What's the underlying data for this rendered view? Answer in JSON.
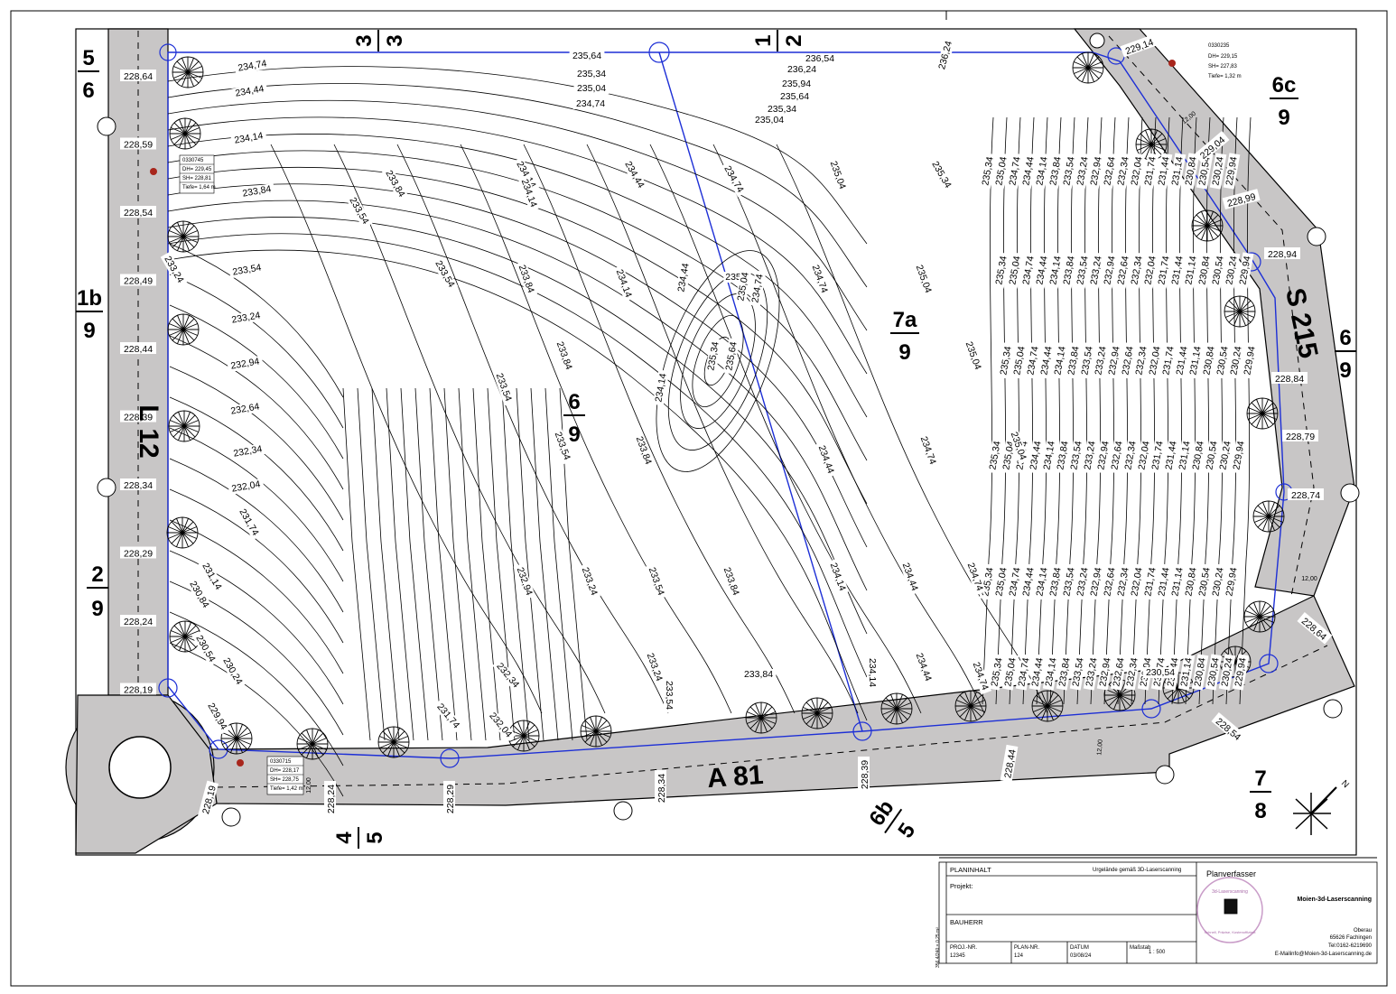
{
  "map": {
    "roads": [
      {
        "name": "L 12"
      },
      {
        "name": "A 81"
      },
      {
        "name": "S 215"
      }
    ],
    "parcels": {
      "p56": {
        "num": "5",
        "den": "6"
      },
      "p1b9": {
        "num": "1b",
        "den": "9"
      },
      "p29": {
        "num": "2",
        "den": "9"
      },
      "p33": {
        "num": "3",
        "den": "3"
      },
      "p12": {
        "num": "1",
        "den": "2"
      },
      "p6c9": {
        "num": "6c",
        "den": "9"
      },
      "p69r": {
        "num": "6",
        "den": "9"
      },
      "p69c": {
        "num": "6",
        "den": "9"
      },
      "p7a9": {
        "num": "7a",
        "den": "9"
      },
      "p78": {
        "num": "7",
        "den": "8"
      },
      "p54": {
        "num": "4",
        "den": "5"
      },
      "p6b5": {
        "num": "6b",
        "den": "5"
      }
    },
    "road_levels_l12": [
      "228,64",
      "228,59",
      "228,54",
      "228,49",
      "228,44",
      "228,39",
      "228,34",
      "228,29",
      "228,24",
      "228,19"
    ],
    "road_levels_a81": [
      "228,19",
      "228,24",
      "228,29",
      "228,34",
      "228,39",
      "228,44"
    ],
    "road_levels_s215": [
      "229,14",
      "229,04",
      "228,99",
      "228,94",
      "228,84",
      "228,79",
      "228,74",
      "228,64",
      "228,54"
    ],
    "road_width_marks": [
      "12,00",
      "12,00",
      "12,00",
      "12,00"
    ],
    "contours_top": [
      "236,24",
      "236,54",
      "236,24",
      "235,94",
      "235,64",
      "235,34",
      "235,04",
      "234,74",
      "234,44",
      "234,14",
      "233,84",
      "233,54",
      "233,24",
      "232,94",
      "232,64",
      "232,34",
      "232,04",
      "231,74",
      "231,44",
      "231,14",
      "230,84",
      "230,54",
      "230,24",
      "229,94"
    ],
    "contours_west": [
      "234,74",
      "234,44",
      "234,14",
      "233,84",
      "233,54",
      "233,24",
      "232,94",
      "232,64",
      "232,34",
      "232,04",
      "231,74",
      "231,14",
      "230,84",
      "230,54",
      "230,24",
      "229,94"
    ],
    "contours_middle": [
      "235,64",
      "235,34",
      "235,04",
      "234,74",
      "234,44",
      "234,14",
      "233,84",
      "233,54",
      "233,24",
      "232,94",
      "232,64",
      "232,34",
      "232,04",
      "231,74",
      "231,44",
      "231,14",
      "230,84",
      "230,54",
      "230,24"
    ],
    "contours_hill": [
      "235",
      "235,04",
      "235,34",
      "235,64",
      "234,74",
      "234,44",
      "234,14"
    ],
    "contours_east": [
      "235,34",
      "235,04",
      "234,74",
      "234,44",
      "234,14",
      "233,84",
      "233,54",
      "233,24",
      "232,94",
      "232,64",
      "232,34",
      "232,04",
      "231,74",
      "231,44",
      "231,14",
      "230,84",
      "230,54",
      "230,24",
      "229,94"
    ],
    "manholes": [
      {
        "id": "0330745",
        "dh": "DH= 229,45",
        "sh": "SH= 228,81",
        "tiefe": "Tiefe= 1,64 m"
      },
      {
        "id": "0330715",
        "dh": "DH= 228,17",
        "sh": "SH= 228,75",
        "tiefe": "Tiefe= 1,42 m"
      },
      {
        "id": "0330235",
        "dh": "DH= 229,15",
        "sh": "SH= 227,83",
        "tiefe": "Tiefe= 1,32 m"
      }
    ],
    "north_arrow": "N"
  },
  "titleblock": {
    "planinhalt_label": "PLANINHALT",
    "planinhalt_value": "Urgelände gemäß 3D-Laserscanning",
    "projekt_label": "Projekt:",
    "bauherr_label": "BAUHERR",
    "proj_nr_label": "PROJ.-NR.",
    "proj_nr": "12345",
    "plan_nr_label": "PLAN-NR.",
    "plan_nr": "124",
    "datum_label": "DATUM",
    "datum": "03/08/24",
    "massstab_label": "Maßstab",
    "massstab": "1 : 500",
    "planverfasser": "Planverfasser",
    "company": "Moien-3d-Laserscanning",
    "addr1": "Oberau",
    "addr2": "65626 Fachingen",
    "tel": "Tel:0162-6219690",
    "email": "E-Mailinfo@Moien-3d-Laserscanning.de",
    "logo_text": "3d-Laserscanning",
    "logo_sub": "Schnell, Präzise, Kostenoffizient",
    "side_note": "356.4/240 = 0,25 m²"
  },
  "colors": {
    "road": "#c8c6c6",
    "boundary": "#1d2fd6",
    "manhole": "#a8261c"
  }
}
